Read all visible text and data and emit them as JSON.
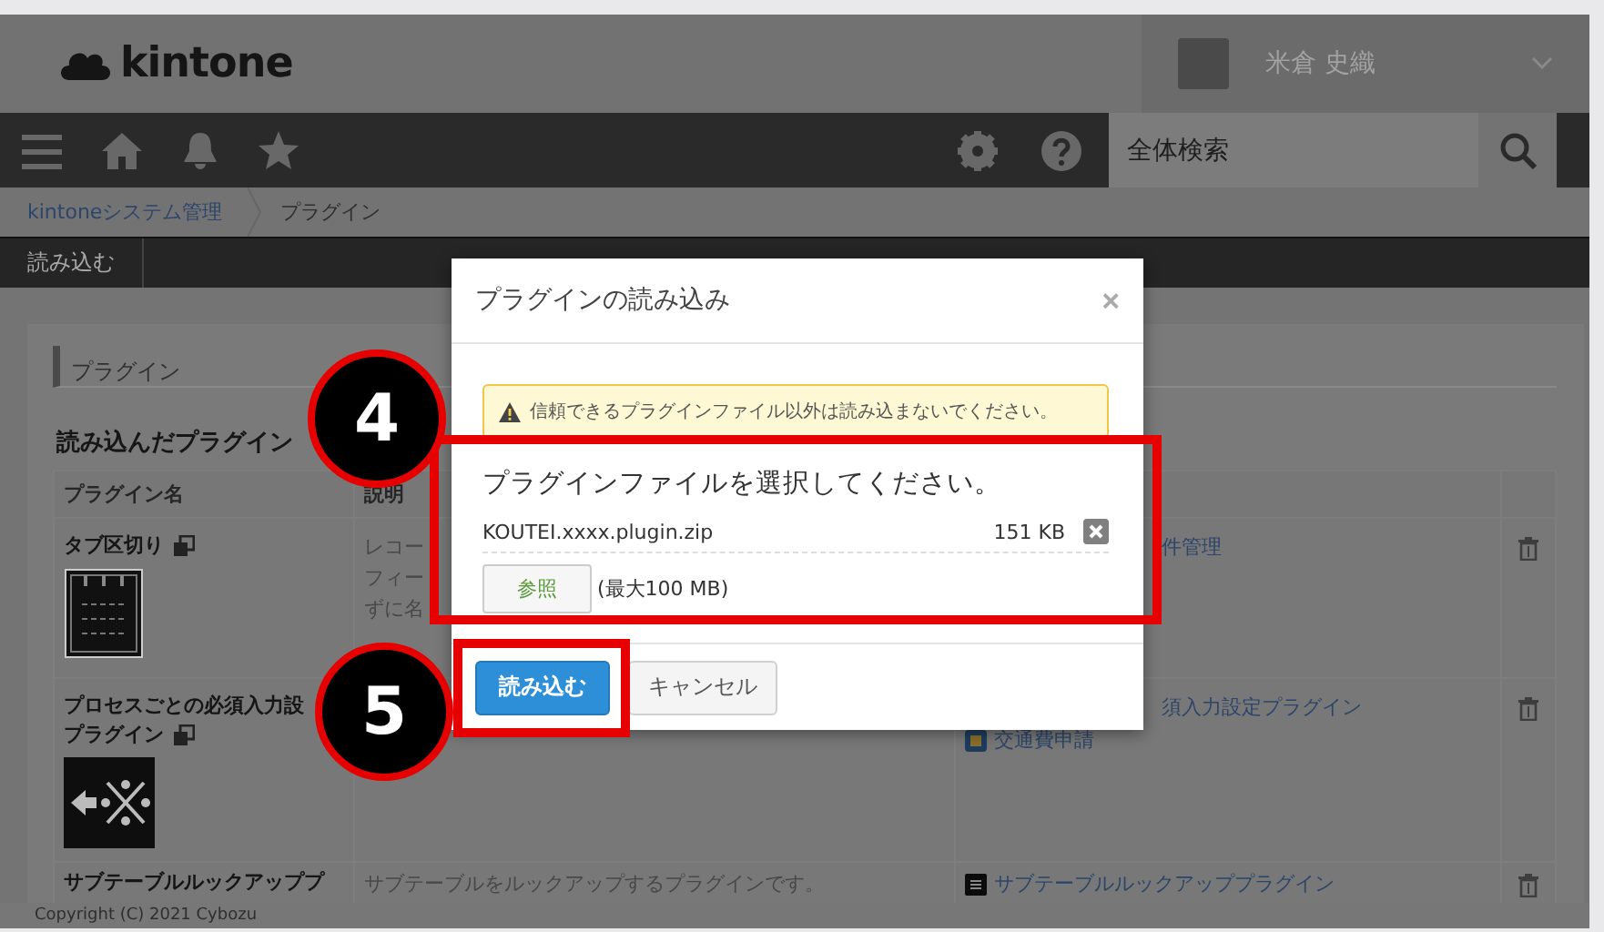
{
  "header": {
    "logo": "kintone",
    "user_name": "米倉 史織"
  },
  "nav": {
    "search": {
      "placeholder": "全体検索"
    }
  },
  "breadcrumb": [
    {
      "label": "kintoneシステム管理",
      "kind": "link"
    },
    {
      "label": "プラグイン",
      "kind": "current"
    }
  ],
  "toolbar": {
    "buttons": [
      "読み込む"
    ]
  },
  "panel": {
    "title": "プラグイン",
    "section_title": "読み込んだプラグイン",
    "table": {
      "columns": [
        "プラグイン名",
        "説明"
      ],
      "rows": [
        {
          "name_lines": [
            "タブ区切り"
          ],
          "copy_icon": true,
          "kind": "tab",
          "description_lines": [
            "レコー",
            "フィー",
            "ずに名"
          ],
          "apps": [
            {
              "label": "件管理",
              "kind": "cut"
            }
          ]
        },
        {
          "name_lines": [
            "プロセスごとの必須入力設",
            "プラグイン"
          ],
          "copy_icon": true,
          "kind": "process",
          "description_lines": [],
          "apps": [
            {
              "label": "須入力設定プラグイン",
              "kind": "cut"
            },
            {
              "label": "交通費申請",
              "kind": "app"
            }
          ]
        },
        {
          "name_lines": [
            "サブテーブルルックアッププ"
          ],
          "copy_icon": false,
          "kind": "plain",
          "description_lines": [
            "サブテーブルをルックアップするプラグインです。"
          ],
          "apps": [
            {
              "label": "サブテーブルルックアッププラグイン",
              "kind": "dark"
            }
          ]
        }
      ]
    }
  },
  "dialog": {
    "title": "プラグインの読み込み",
    "close": "×",
    "warning": "信頼できるプラグインファイル以外は読み込まないでください。",
    "prompt": "プラグインファイルを選択してください。",
    "file": {
      "name": "KOUTEI.xxxx.plugin.zip",
      "size": "151 KB"
    },
    "browse_button": "参照",
    "limit": "(最大100 MB)",
    "buttons": [
      {
        "label": "読み込む",
        "kind": "primary"
      },
      {
        "label": "キャンセル",
        "kind": "secondary"
      }
    ]
  },
  "annotations": [
    {
      "number": "4"
    },
    {
      "number": "5"
    }
  ],
  "footer": "Copyright (C) 2021 Cybozu"
}
